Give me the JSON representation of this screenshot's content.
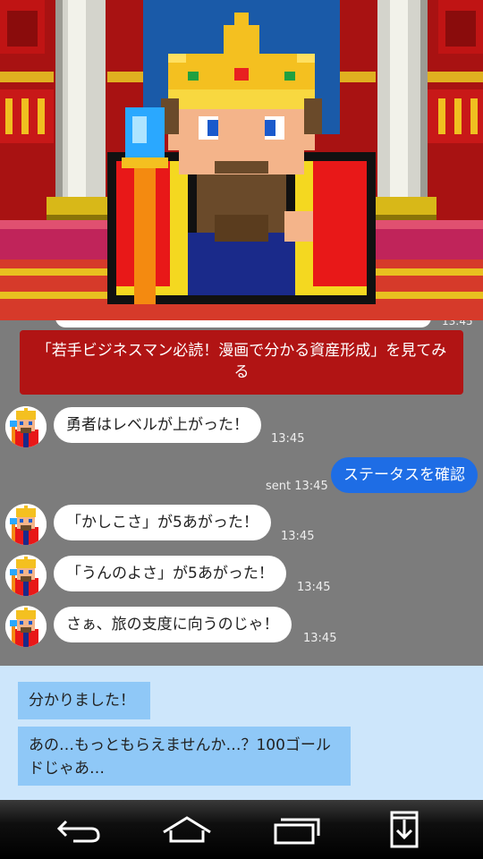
{
  "chat": {
    "partial_time": "13:45",
    "link_card": "「若手ビジネスマン必読！漫画で分かる資産形成」を見てみる",
    "messages": [
      {
        "text": "勇者はレベルが上がった！",
        "time": "13:45"
      },
      {
        "status": "sent",
        "time": "13:45",
        "text": "ステータスを確認"
      },
      {
        "text": "「かしこさ」が5あがった！",
        "time": "13:45"
      },
      {
        "text": "「うんのよさ」が5あがった！",
        "time": "13:45"
      },
      {
        "text": "さぁ、旅の支度に向うのじゃ！",
        "time": "13:45"
      }
    ]
  },
  "replies": [
    {
      "text": "分かりました！"
    },
    {
      "text": "あの…もっともらえませんか…？100ゴールドじゃあ…"
    }
  ],
  "navbar": {
    "icons": [
      "back-icon",
      "home-icon",
      "recent-apps-icon",
      "download-icon"
    ]
  },
  "colors": {
    "accent_red": "#b11414",
    "sent_bubble": "#1e6de5",
    "reply_panel": "#cde6fb",
    "reply_choice": "#8fc8f7"
  }
}
